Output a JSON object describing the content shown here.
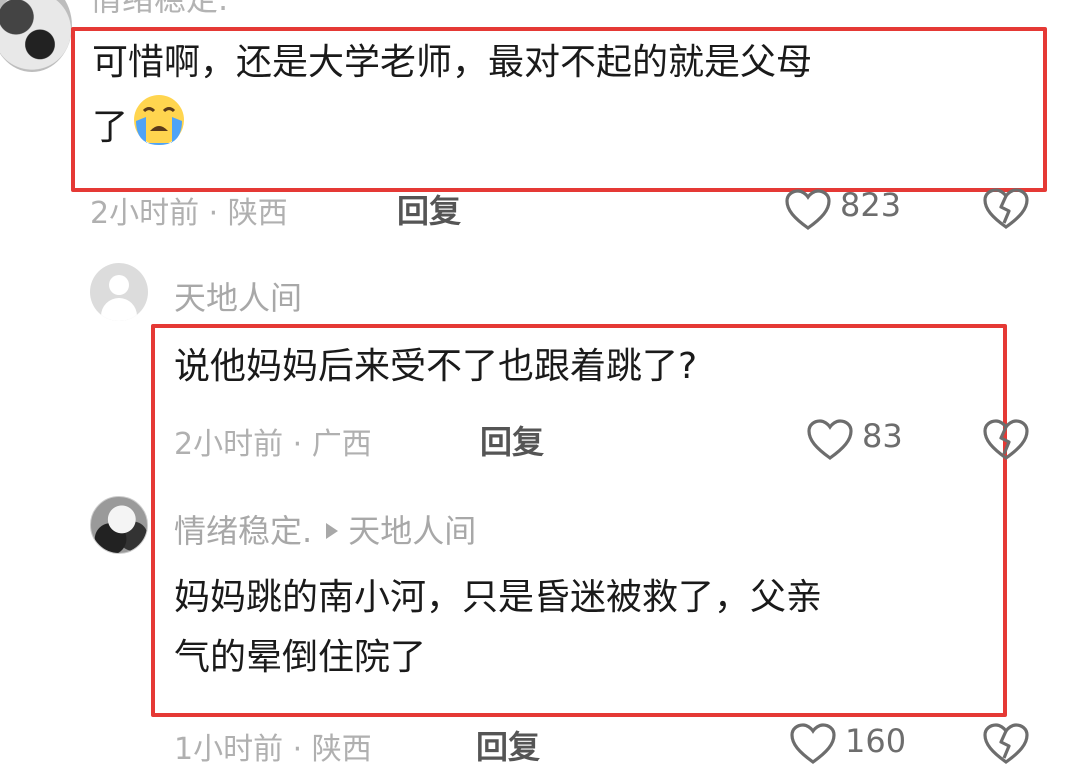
{
  "comments": [
    {
      "username": "情绪稳定.",
      "text_line1": "可惜啊，还是大学老师，最对不起的就是父母",
      "text_line2": "了",
      "emoji": "crying-emoji",
      "meta": "2小时前 · 陕西",
      "reply": "回复",
      "likes": "823"
    },
    {
      "username": "天地人间",
      "text_line1": "说他妈妈后来受不了也跟着跳了?",
      "meta": "2小时前 · 广西",
      "reply": "回复",
      "likes": "83"
    },
    {
      "username": "情绪稳定.",
      "reply_to": "天地人间",
      "text_line1": "妈妈跳的南小河，只是昏迷被救了，父亲",
      "text_line2": "气的晕倒住院了",
      "meta": "1小时前 · 陕西",
      "reply": "回复",
      "likes": "160"
    }
  ],
  "colors": {
    "highlight_box": "#e53935",
    "meta_text": "#b0b0b0",
    "emoji_face": "#ffd54f",
    "emoji_tears": "#4fa3f7"
  }
}
